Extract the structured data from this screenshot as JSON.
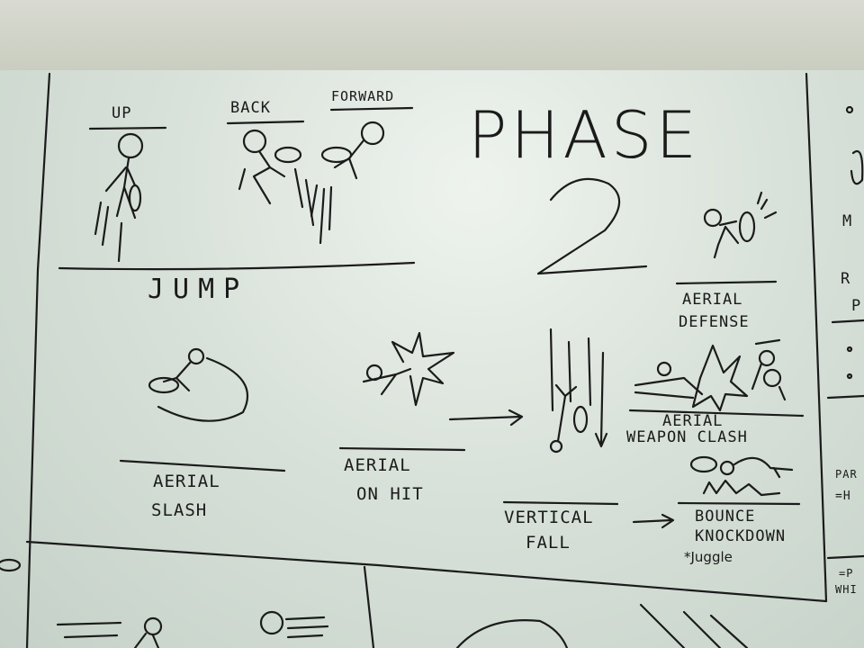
{
  "title": {
    "line1": "PHASE",
    "line2": "2"
  },
  "jump": {
    "label": "JUMP",
    "directions": [
      "UP",
      "BACK",
      "FORWARD"
    ]
  },
  "moves": {
    "aerial_slash": [
      "AERIAL",
      "SLASH"
    ],
    "aerial_on_hit": [
      "AERIAL",
      "ON HIT"
    ],
    "vertical_fall": [
      "VERTICAL",
      "FALL"
    ],
    "aerial_defense": [
      "AERIAL",
      "DEFENSE"
    ],
    "aerial_weapon_clash": [
      "AERIAL",
      "WEAPON CLASH"
    ],
    "bounce_knockdown": [
      "BOUNCE",
      "KNOCKDOWN",
      "*Juggle"
    ]
  },
  "right_panel": {
    "frags": [
      "M",
      "R",
      "P",
      "PAR",
      "=H",
      "=P",
      "WHI"
    ]
  }
}
